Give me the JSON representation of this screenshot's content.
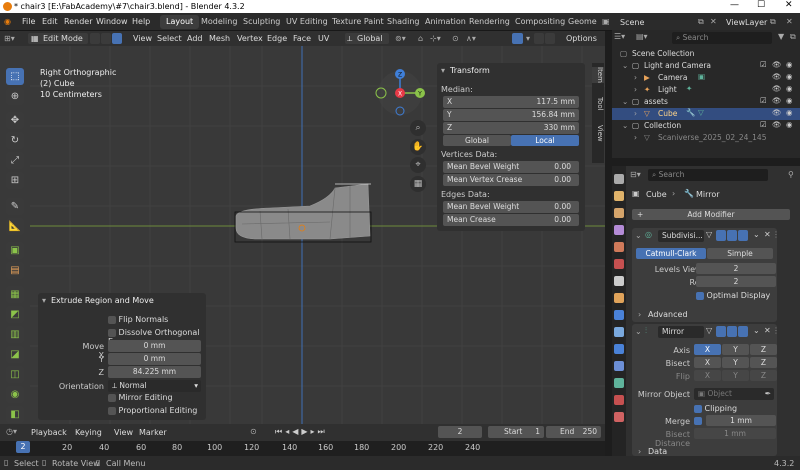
{
  "window": {
    "title": "* chair3 [E:\\FabAcademy\\#7\\chair3.blend] - Blender 4.3.2"
  },
  "menu": [
    "File",
    "Edit",
    "Render",
    "Window",
    "Help"
  ],
  "workspaces": [
    {
      "label": "Layout",
      "active": true
    },
    {
      "label": "Modeling"
    },
    {
      "label": "Sculpting"
    },
    {
      "label": "UV Editing"
    },
    {
      "label": "Texture Paint"
    },
    {
      "label": "Shading"
    },
    {
      "label": "Animation"
    },
    {
      "label": "Rendering"
    },
    {
      "label": "Compositing"
    },
    {
      "label": "Geome"
    }
  ],
  "scene": {
    "label": "Scene",
    "view_layer": "ViewLayer"
  },
  "viewport_header": {
    "mode": "Edit Mode",
    "menus": [
      "View",
      "Select",
      "Add",
      "Mesh",
      "Vertex",
      "Edge",
      "Face",
      "UV"
    ],
    "transform_orientation": "Global",
    "options": "Options"
  },
  "viewport": {
    "view_name": "Right Orthographic",
    "object_info": "(2) Cube",
    "scale_info": "10 Centimeters"
  },
  "gizmo": {
    "z": "Z",
    "y": "Y",
    "x": "X",
    "neg_y": "-Y"
  },
  "npanel": {
    "title": "Transform",
    "median_label": "Median:",
    "x_label": "X",
    "x_value": "117.5 mm",
    "y_label": "Y",
    "y_value": "156.84 mm",
    "z_label": "Z",
    "z_value": "330 mm",
    "global": "Global",
    "local": "Local",
    "vertices_data": "Vertices Data:",
    "mean_bevel_weight_label": "Mean Bevel Weight",
    "mean_bevel_weight_v": "0.00",
    "mean_vertex_crease_label": "Mean Vertex Crease",
    "mean_vertex_crease": "0.00",
    "edges_data": "Edges Data:",
    "edge_bevel_weight_label": "Mean Bevel Weight",
    "edge_bevel_weight": "0.00",
    "mean_crease_label": "Mean Crease",
    "mean_crease": "0.00",
    "tabs": [
      "Item",
      "Tool",
      "View"
    ]
  },
  "operator": {
    "title": "Extrude Region and Move",
    "flip_normals": "Flip Normals",
    "dissolve": "Dissolve Orthogonal E...",
    "move_x_label": "Move X",
    "move_x": "0 mm",
    "move_y_label": "Y",
    "move_y": "0 mm",
    "move_z_label": "Z",
    "move_z": "84.225 mm",
    "orientation_label": "Orientation",
    "orientation": "Normal",
    "mirror_editing": "Mirror Editing",
    "proportional_editing": "Proportional Editing"
  },
  "timeline": {
    "menus": [
      "Playback",
      "Keying",
      "View",
      "Marker"
    ],
    "current_frame": "2",
    "start_label": "Start",
    "start": "1",
    "end_label": "End",
    "end": "250",
    "ticks": [
      "2",
      "20",
      "40",
      "60",
      "80",
      "100",
      "120",
      "140",
      "160",
      "180",
      "200",
      "220",
      "240"
    ]
  },
  "statusbar": {
    "select": "Select",
    "rotate": "Rotate View",
    "call_menu": "Call Menu",
    "version": "4.3.2"
  },
  "outliner": {
    "search_placeholder": "Search",
    "rows": [
      {
        "label": "Scene Collection"
      },
      {
        "label": "Light and Camera"
      },
      {
        "label": "Camera"
      },
      {
        "label": "Light"
      },
      {
        "label": "assets"
      },
      {
        "label": "Cube"
      },
      {
        "label": "Collection"
      },
      {
        "label": "Scaniverse_2025_02_24_145"
      }
    ]
  },
  "properties": {
    "search_placeholder": "Search",
    "breadcrumb_object": "Cube",
    "breadcrumb_modifier": "Mirror",
    "add_modifier": "Add Modifier",
    "subdiv": {
      "name": "Subdivisi...",
      "catmull": "Catmull-Clark",
      "simple": "Simple",
      "levels_label": "Levels Viewport",
      "levels": "2",
      "render_label": "Render",
      "render": "2",
      "optimal": "Optimal Display",
      "advanced": "Advanced"
    },
    "mirror": {
      "name": "Mirror",
      "axis_label": "Axis",
      "bisect_label": "Bisect",
      "flip_label": "Flip",
      "x": "X",
      "y": "Y",
      "z": "Z",
      "mirror_object_label": "Mirror Object",
      "mirror_object_placeholder": "Object",
      "clipping": "Clipping",
      "merge_label": "Merge",
      "merge": "1 mm",
      "bisect_distance_label": "Bisect Distance",
      "bisect_distance": "1 mm",
      "data": "Data"
    }
  },
  "colors": {
    "accent": "#4772b3",
    "axis_x": "#e63946",
    "axis_y": "#8bc34a",
    "axis_z": "#3f7fd8"
  }
}
